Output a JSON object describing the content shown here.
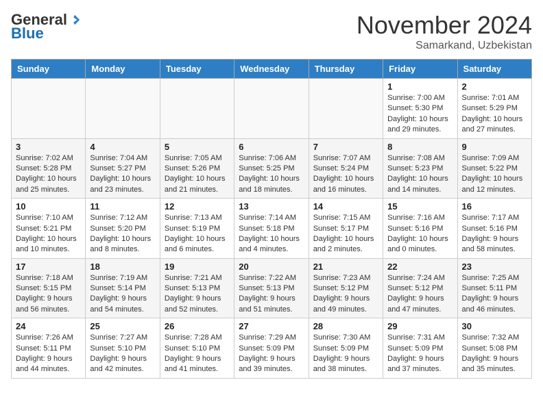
{
  "header": {
    "logo_general": "General",
    "logo_blue": "Blue",
    "month_title": "November 2024",
    "subtitle": "Samarkand, Uzbekistan"
  },
  "calendar": {
    "days_of_week": [
      "Sunday",
      "Monday",
      "Tuesday",
      "Wednesday",
      "Thursday",
      "Friday",
      "Saturday"
    ],
    "weeks": [
      [
        {
          "day": "",
          "info": ""
        },
        {
          "day": "",
          "info": ""
        },
        {
          "day": "",
          "info": ""
        },
        {
          "day": "",
          "info": ""
        },
        {
          "day": "",
          "info": ""
        },
        {
          "day": "1",
          "info": "Sunrise: 7:00 AM\nSunset: 5:30 PM\nDaylight: 10 hours and 29 minutes."
        },
        {
          "day": "2",
          "info": "Sunrise: 7:01 AM\nSunset: 5:29 PM\nDaylight: 10 hours and 27 minutes."
        }
      ],
      [
        {
          "day": "3",
          "info": "Sunrise: 7:02 AM\nSunset: 5:28 PM\nDaylight: 10 hours and 25 minutes."
        },
        {
          "day": "4",
          "info": "Sunrise: 7:04 AM\nSunset: 5:27 PM\nDaylight: 10 hours and 23 minutes."
        },
        {
          "day": "5",
          "info": "Sunrise: 7:05 AM\nSunset: 5:26 PM\nDaylight: 10 hours and 21 minutes."
        },
        {
          "day": "6",
          "info": "Sunrise: 7:06 AM\nSunset: 5:25 PM\nDaylight: 10 hours and 18 minutes."
        },
        {
          "day": "7",
          "info": "Sunrise: 7:07 AM\nSunset: 5:24 PM\nDaylight: 10 hours and 16 minutes."
        },
        {
          "day": "8",
          "info": "Sunrise: 7:08 AM\nSunset: 5:23 PM\nDaylight: 10 hours and 14 minutes."
        },
        {
          "day": "9",
          "info": "Sunrise: 7:09 AM\nSunset: 5:22 PM\nDaylight: 10 hours and 12 minutes."
        }
      ],
      [
        {
          "day": "10",
          "info": "Sunrise: 7:10 AM\nSunset: 5:21 PM\nDaylight: 10 hours and 10 minutes."
        },
        {
          "day": "11",
          "info": "Sunrise: 7:12 AM\nSunset: 5:20 PM\nDaylight: 10 hours and 8 minutes."
        },
        {
          "day": "12",
          "info": "Sunrise: 7:13 AM\nSunset: 5:19 PM\nDaylight: 10 hours and 6 minutes."
        },
        {
          "day": "13",
          "info": "Sunrise: 7:14 AM\nSunset: 5:18 PM\nDaylight: 10 hours and 4 minutes."
        },
        {
          "day": "14",
          "info": "Sunrise: 7:15 AM\nSunset: 5:17 PM\nDaylight: 10 hours and 2 minutes."
        },
        {
          "day": "15",
          "info": "Sunrise: 7:16 AM\nSunset: 5:16 PM\nDaylight: 10 hours and 0 minutes."
        },
        {
          "day": "16",
          "info": "Sunrise: 7:17 AM\nSunset: 5:16 PM\nDaylight: 9 hours and 58 minutes."
        }
      ],
      [
        {
          "day": "17",
          "info": "Sunrise: 7:18 AM\nSunset: 5:15 PM\nDaylight: 9 hours and 56 minutes."
        },
        {
          "day": "18",
          "info": "Sunrise: 7:19 AM\nSunset: 5:14 PM\nDaylight: 9 hours and 54 minutes."
        },
        {
          "day": "19",
          "info": "Sunrise: 7:21 AM\nSunset: 5:13 PM\nDaylight: 9 hours and 52 minutes."
        },
        {
          "day": "20",
          "info": "Sunrise: 7:22 AM\nSunset: 5:13 PM\nDaylight: 9 hours and 51 minutes."
        },
        {
          "day": "21",
          "info": "Sunrise: 7:23 AM\nSunset: 5:12 PM\nDaylight: 9 hours and 49 minutes."
        },
        {
          "day": "22",
          "info": "Sunrise: 7:24 AM\nSunset: 5:12 PM\nDaylight: 9 hours and 47 minutes."
        },
        {
          "day": "23",
          "info": "Sunrise: 7:25 AM\nSunset: 5:11 PM\nDaylight: 9 hours and 46 minutes."
        }
      ],
      [
        {
          "day": "24",
          "info": "Sunrise: 7:26 AM\nSunset: 5:11 PM\nDaylight: 9 hours and 44 minutes."
        },
        {
          "day": "25",
          "info": "Sunrise: 7:27 AM\nSunset: 5:10 PM\nDaylight: 9 hours and 42 minutes."
        },
        {
          "day": "26",
          "info": "Sunrise: 7:28 AM\nSunset: 5:10 PM\nDaylight: 9 hours and 41 minutes."
        },
        {
          "day": "27",
          "info": "Sunrise: 7:29 AM\nSunset: 5:09 PM\nDaylight: 9 hours and 39 minutes."
        },
        {
          "day": "28",
          "info": "Sunrise: 7:30 AM\nSunset: 5:09 PM\nDaylight: 9 hours and 38 minutes."
        },
        {
          "day": "29",
          "info": "Sunrise: 7:31 AM\nSunset: 5:09 PM\nDaylight: 9 hours and 37 minutes."
        },
        {
          "day": "30",
          "info": "Sunrise: 7:32 AM\nSunset: 5:08 PM\nDaylight: 9 hours and 35 minutes."
        }
      ]
    ]
  }
}
